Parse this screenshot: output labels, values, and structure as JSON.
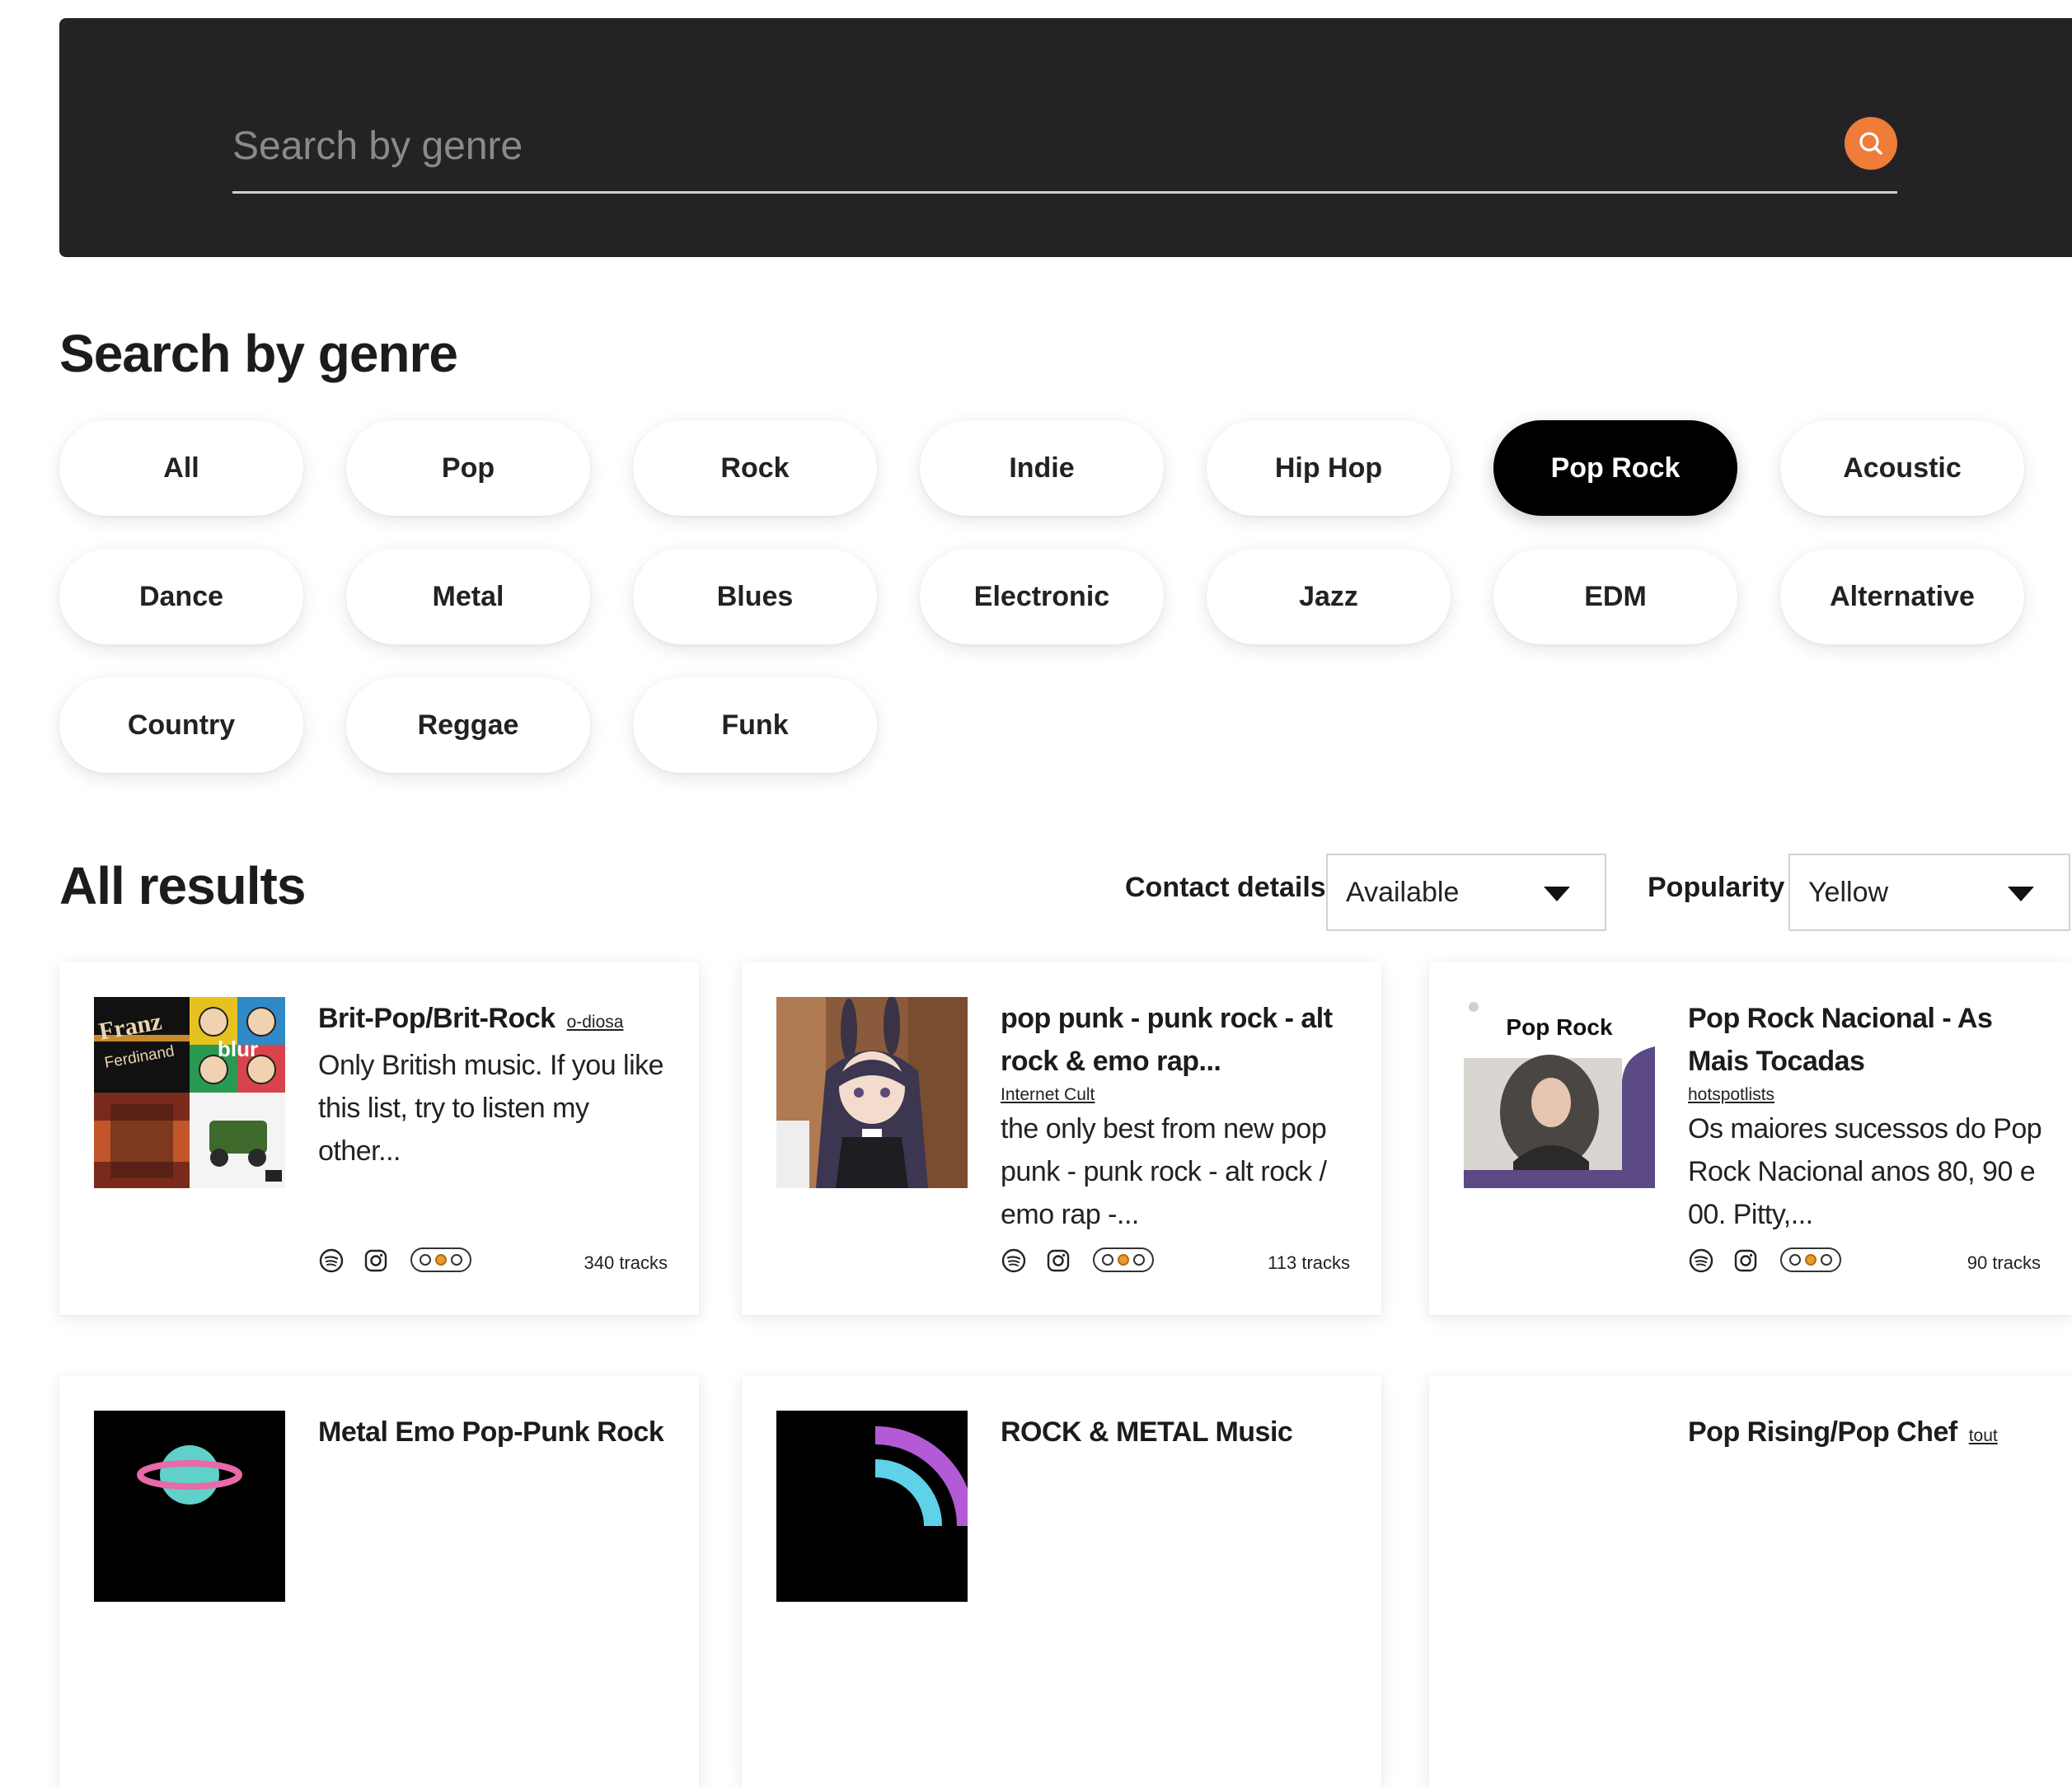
{
  "search": {
    "placeholder": "Search by genre"
  },
  "genres": {
    "title": "Search by genre",
    "items": [
      "All",
      "Pop",
      "Rock",
      "Indie",
      "Hip Hop",
      "Pop Rock",
      "Acoustic",
      "Dance",
      "Metal",
      "Blues",
      "Electronic",
      "Jazz",
      "EDM",
      "Alternative",
      "Country",
      "Reggae",
      "Funk"
    ],
    "active": "Pop Rock"
  },
  "results": {
    "title": "All results",
    "filters": {
      "contact_label": "Contact details",
      "contact_value": "Available",
      "popularity_label": "Popularity",
      "popularity_value": "Yellow"
    },
    "cards": [
      {
        "title": "Brit-Pop/Brit-Rock",
        "author": "o-diosa",
        "description": "Only British music. If you like this list, try to listen my other...",
        "tracks": "340 tracks",
        "popularity_level": 1,
        "thumb_text": [
          "Franz",
          "Ferdinand",
          "blur"
        ]
      },
      {
        "title": "pop punk - punk rock - alt rock & emo rap...",
        "author": "Internet Cult",
        "description": "the only best from new pop punk - punk rock - alt rock / emo rap -...",
        "tracks": "113 tracks",
        "popularity_level": 1
      },
      {
        "title": "Pop Rock Nacional - As Mais Tocadas",
        "author": "hotspotlists",
        "description": "Os maiores sucessos do Pop Rock Nacional anos 80, 90 e 00. Pitty,...",
        "tracks": "90 tracks",
        "popularity_level": 1,
        "thumb_text": "Pop Rock"
      },
      {
        "title": "Metal Emo Pop-Punk Rock",
        "author": "",
        "description": ""
      },
      {
        "title": "ROCK & METAL Music",
        "author": "",
        "description": ""
      },
      {
        "title": "Pop Rising/Pop Chef",
        "author": "tout",
        "description": ""
      }
    ]
  },
  "colors": {
    "banner": "#232325",
    "accent": "#ef7c38",
    "active_pill": "#000000",
    "popularity_yellow": "#e69b2b"
  },
  "icons": [
    "search-icon",
    "spotify-icon",
    "instagram-icon",
    "caret-down-icon"
  ]
}
